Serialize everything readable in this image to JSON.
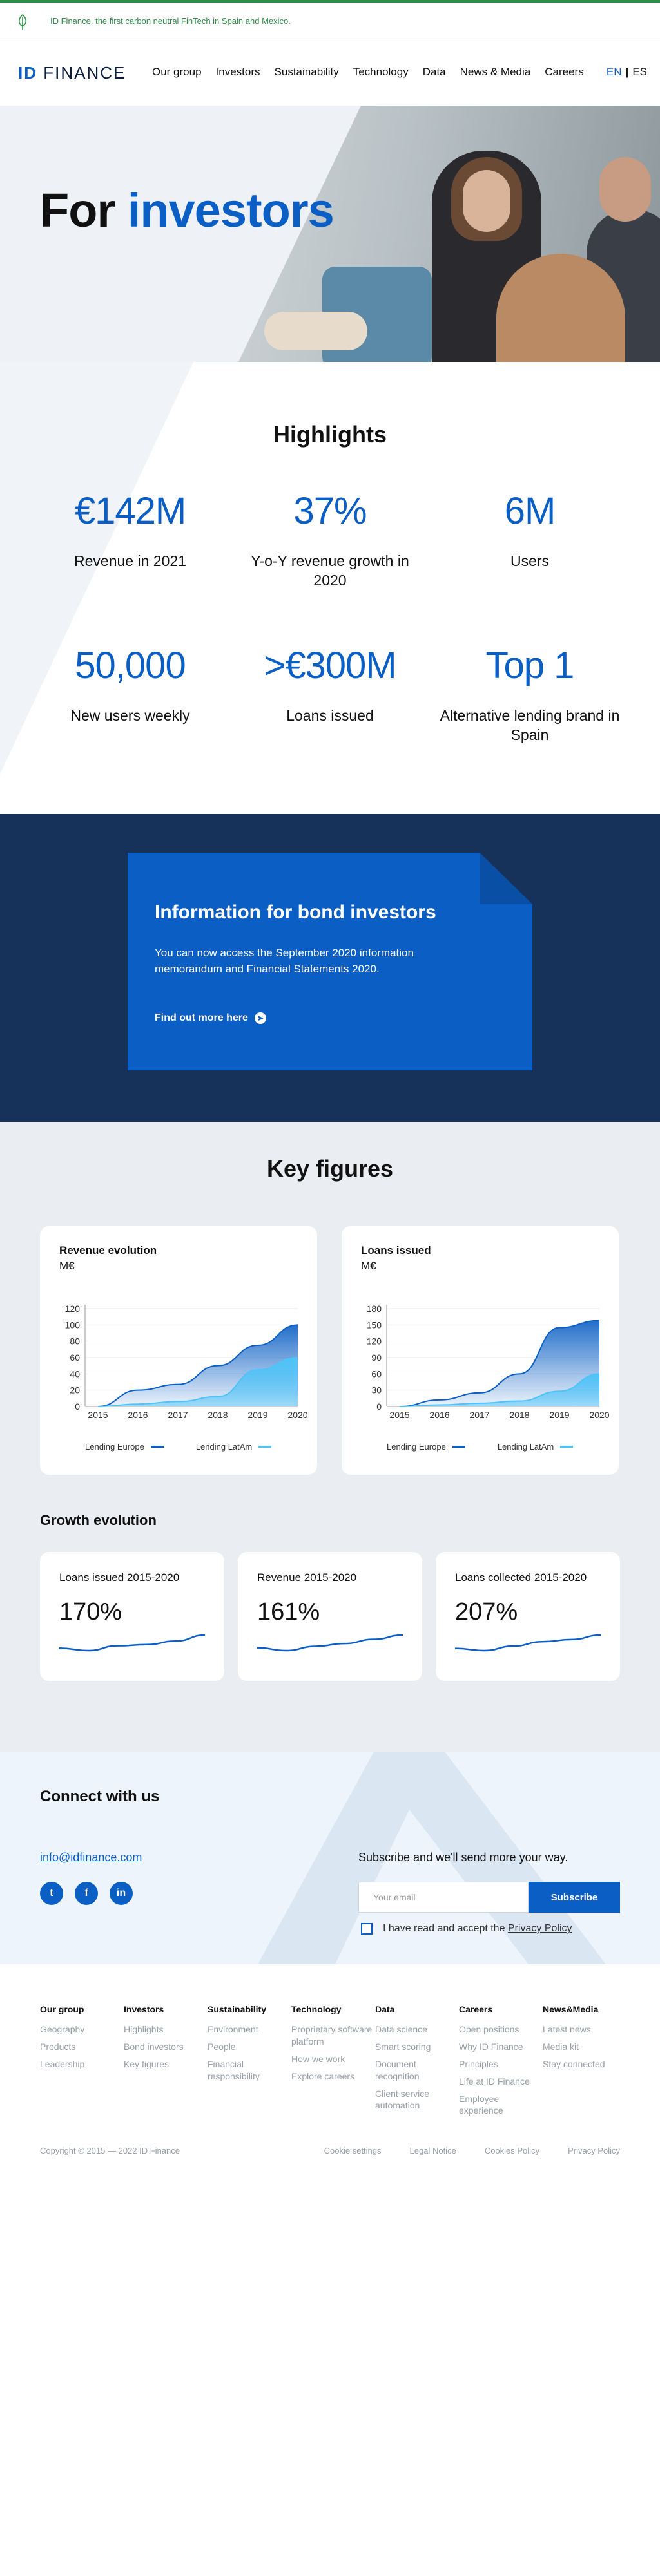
{
  "topbar": {
    "message": "ID Finance, the first carbon neutral FinTech in Spain and Mexico."
  },
  "header": {
    "logo_id": "ID",
    "logo_word": "FINANCE",
    "nav": [
      "Our group",
      "Investors",
      "Sustainability",
      "Technology",
      "Data",
      "News & Media",
      "Careers"
    ],
    "lang_en": "EN",
    "lang_sep": "|",
    "lang_es": "ES"
  },
  "hero": {
    "title_plain": "For ",
    "title_accent": "investors"
  },
  "highlights": {
    "title": "Highlights",
    "stats": [
      {
        "value": "€142M",
        "label": "Revenue in 2021"
      },
      {
        "value": "37%",
        "label": "Y-o-Y revenue growth in 2020"
      },
      {
        "value": "6M",
        "label": "Users"
      },
      {
        "value": "50,000",
        "label": "New users weekly"
      },
      {
        "value": ">€300M",
        "label": "Loans issued"
      },
      {
        "value": "Top 1",
        "label": "Alternative lending brand in Spain"
      }
    ]
  },
  "bond": {
    "title": "Information for bond investors",
    "text": "You can now access the September 2020 information memorandum and Financial Statements 2020.",
    "link": "Find out more here"
  },
  "keyfigures": {
    "title": "Key figures",
    "growth_title": "Growth evolution",
    "growth": [
      {
        "title": "Loans issued 2015-2020",
        "value": "170%",
        "trend": [
          6,
          4,
          8,
          9,
          12,
          17
        ]
      },
      {
        "title": "Revenue 2015-2020",
        "value": "161%",
        "trend": [
          7,
          5,
          8,
          10,
          13,
          16
        ]
      },
      {
        "title": "Loans collected 2015-2020",
        "value": "207%",
        "trend": [
          5,
          3,
          7,
          11,
          13,
          17
        ]
      }
    ],
    "colors": {
      "europe": "#0b5fc4",
      "latam": "#4fc3f7"
    }
  },
  "chart_data": [
    {
      "type": "area",
      "title": "Revenue evolution",
      "ylabel": "M€",
      "x": [
        "2015",
        "2016",
        "2017",
        "2018",
        "2019",
        "2020"
      ],
      "ylim": [
        0,
        120
      ],
      "yticks": [
        0,
        20,
        40,
        60,
        80,
        100,
        120
      ],
      "series": [
        {
          "name": "Lending Europe",
          "values": [
            0,
            20,
            27,
            50,
            75,
            100
          ]
        },
        {
          "name": "Lending LatAm",
          "values": [
            0,
            3,
            6,
            12,
            45,
            60
          ]
        }
      ],
      "legend": "bottom"
    },
    {
      "type": "area",
      "title": "Loans issued",
      "ylabel": "M€",
      "x": [
        "2015",
        "2016",
        "2017",
        "2018",
        "2019",
        "2020"
      ],
      "ylim": [
        0,
        180
      ],
      "yticks": [
        0,
        30,
        60,
        90,
        120,
        150,
        180
      ],
      "series": [
        {
          "name": "Lending Europe",
          "values": [
            0,
            12,
            25,
            60,
            145,
            158
          ]
        },
        {
          "name": "Lending LatAm",
          "values": [
            0,
            3,
            6,
            10,
            28,
            60
          ]
        }
      ],
      "legend": "bottom"
    }
  ],
  "connect": {
    "title": "Connect with us",
    "email": "info@idfinance.com",
    "social_twitter": "t",
    "social_facebook": "f",
    "social_linkedin": "in",
    "subscribe_text": "Subscribe and we'll send more your way.",
    "email_placeholder": "Your email",
    "subscribe_button": "Subscribe",
    "consent_text": "I have read and accept the ",
    "privacy_link": "Privacy Policy"
  },
  "footer": {
    "columns": [
      {
        "heading": "Our group",
        "items": [
          "Geography",
          "Products",
          "Leadership"
        ]
      },
      {
        "heading": "Investors",
        "items": [
          "Highlights",
          "Bond investors",
          "Key figures"
        ]
      },
      {
        "heading": "Sustainability",
        "items": [
          "Environment",
          "People",
          "Financial responsibility"
        ]
      },
      {
        "heading": "Technology",
        "items": [
          "Proprietary software platform",
          "How we work",
          "Explore careers"
        ]
      },
      {
        "heading": "Data",
        "items": [
          "Data science",
          "Smart scoring",
          "Document recognition",
          "Client service automation"
        ]
      },
      {
        "heading": "Careers",
        "items": [
          "Open positions",
          "Why ID Finance",
          "Principles",
          "Life at ID Finance",
          "Employee experience"
        ]
      },
      {
        "heading": "News&Media",
        "items": [
          "Latest news",
          "Media kit",
          "Stay connected"
        ]
      }
    ],
    "copyright": "Copyright © 2015 — 2022 ID Finance",
    "links": [
      "Cookie settings",
      "Legal Notice",
      "Cookies Policy",
      "Privacy Policy"
    ]
  }
}
